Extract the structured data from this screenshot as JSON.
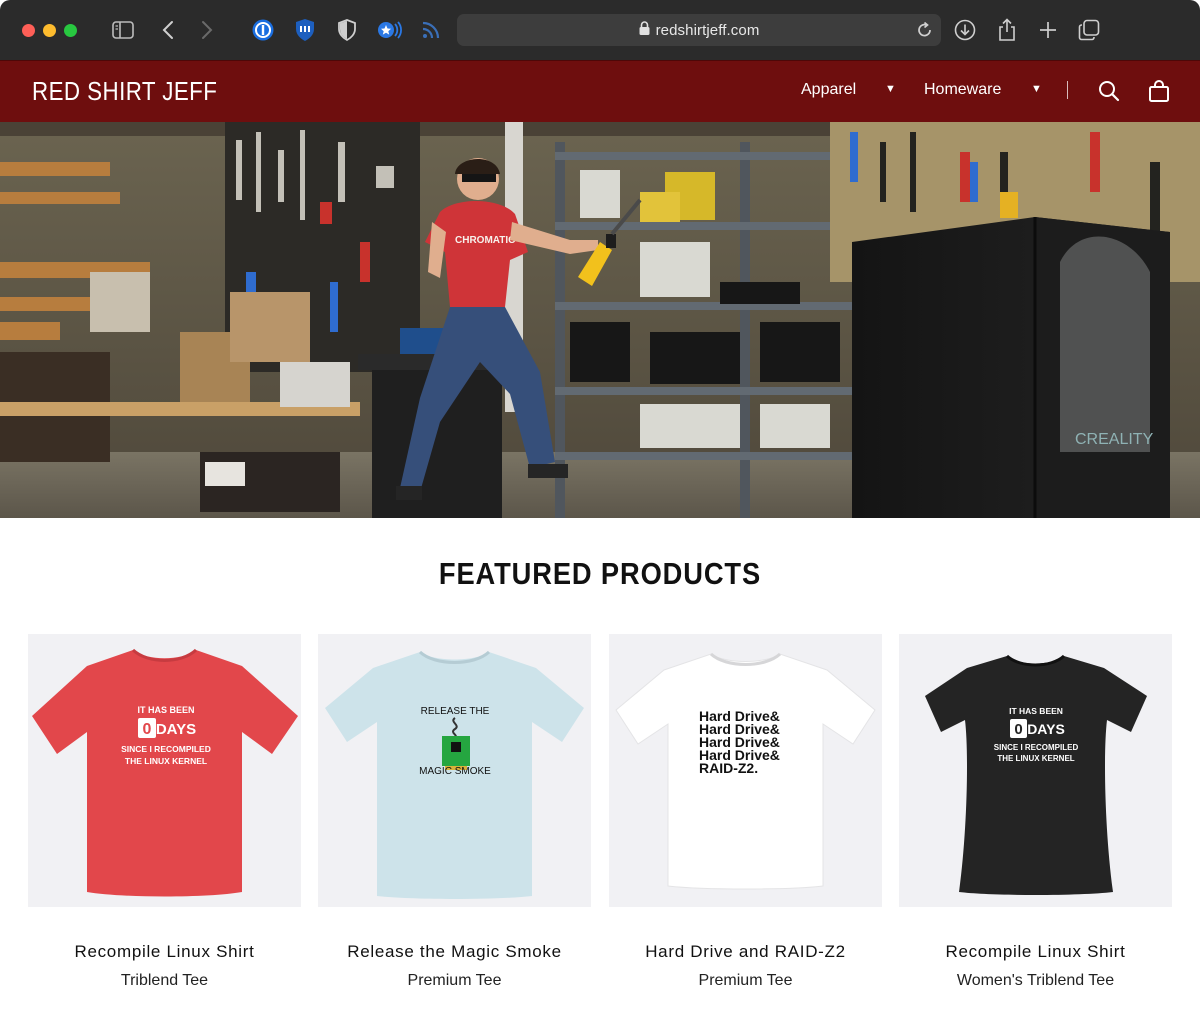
{
  "browser": {
    "url": "redshirtjeff.com"
  },
  "site": {
    "brand": "RED SHIRT JEFF",
    "nav": [
      {
        "label": "Apparel"
      },
      {
        "label": "Homeware"
      }
    ]
  },
  "hero": {
    "shirt_text": "CHROMATIC",
    "tent_text": "CREALITY"
  },
  "featured": {
    "title": "FEATURED PRODUCTS",
    "products": [
      {
        "name": "Recompile Linux Shirt",
        "type": "Triblend Tee",
        "shirt_color": "#e2474b",
        "print": [
          "IT HAS BEEN",
          "0",
          "DAYS",
          "SINCE I RECOMPILED",
          "THE LINUX KERNEL"
        ]
      },
      {
        "name": "Release the Magic Smoke",
        "type": "Premium Tee",
        "shirt_color": "#cde3ea",
        "print": [
          "RELEASE THE",
          "MAGIC SMOKE"
        ]
      },
      {
        "name": "Hard Drive and RAID-Z2",
        "type": "Premium Tee",
        "shirt_color": "#ffffff",
        "print": [
          "Hard Drive&",
          "Hard Drive&",
          "Hard Drive&",
          "Hard Drive&",
          "RAID-Z2."
        ]
      },
      {
        "name": "Recompile Linux Shirt",
        "type": "Women's Triblend Tee",
        "shirt_color": "#242424",
        "print": [
          "IT HAS BEEN",
          "0",
          "DAYS",
          "SINCE I RECOMPILED",
          "THE LINUX KERNEL"
        ]
      }
    ]
  }
}
